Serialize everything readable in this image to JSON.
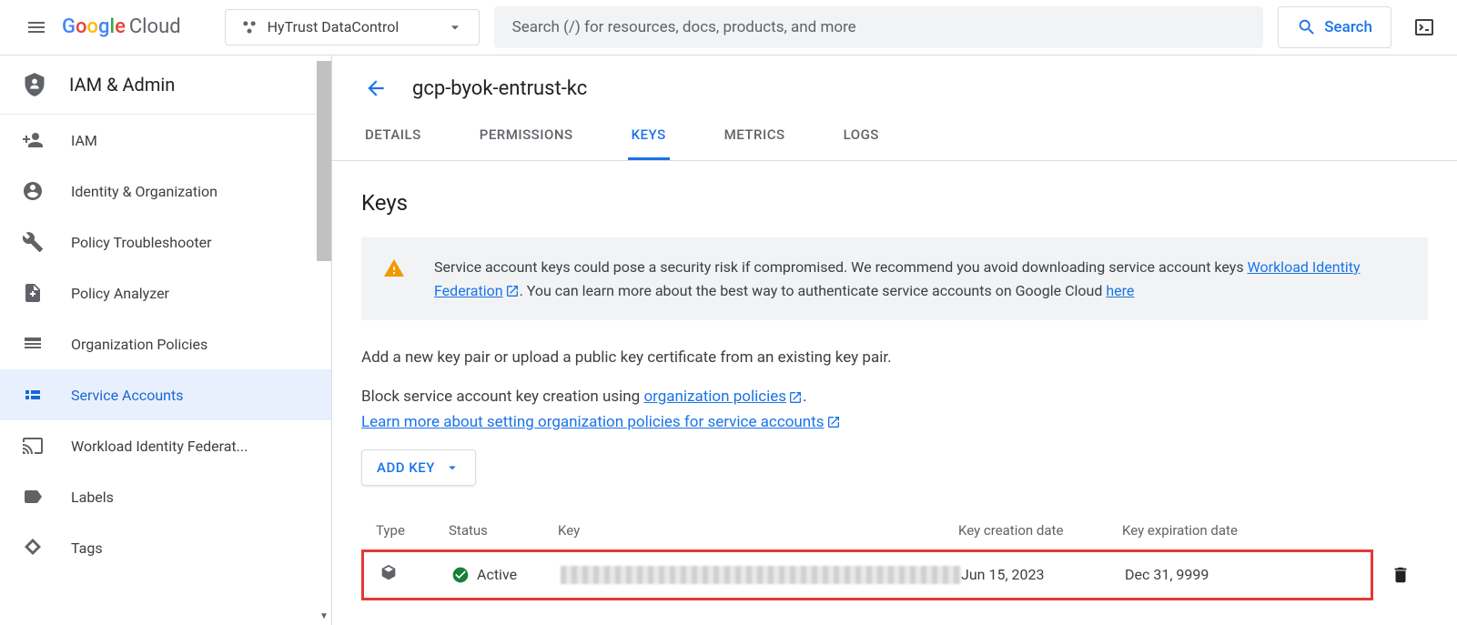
{
  "header": {
    "logo_cloud": "Cloud",
    "project_name": "HyTrust DataControl",
    "search_placeholder": "Search (/) for resources, docs, products, and more",
    "search_button": "Search"
  },
  "sidebar": {
    "section_title": "IAM & Admin",
    "items": [
      {
        "label": "IAM"
      },
      {
        "label": "Identity & Organization"
      },
      {
        "label": "Policy Troubleshooter"
      },
      {
        "label": "Policy Analyzer"
      },
      {
        "label": "Organization Policies"
      },
      {
        "label": "Service Accounts"
      },
      {
        "label": "Workload Identity Federat..."
      },
      {
        "label": "Labels"
      },
      {
        "label": "Tags"
      }
    ]
  },
  "page": {
    "title": "gcp-byok-entrust-kc",
    "tabs": [
      "DETAILS",
      "PERMISSIONS",
      "KEYS",
      "METRICS",
      "LOGS"
    ],
    "heading": "Keys",
    "warning_text1": "Service account keys could pose a security risk if compromised. We recommend you avoid downloading service account keys ",
    "warning_link1": "Workload Identity Federation",
    "warning_text2": ". You can learn more about the best way to authenticate service accounts on Google Cloud ",
    "warning_link2": "here",
    "para1": "Add a new key pair or upload a public key certificate from an existing key pair.",
    "para2a": "Block service account key creation using ",
    "para2_link": "organization policies",
    "para3_link": "Learn more about setting organization policies for service accounts",
    "add_key": "ADD KEY",
    "columns": {
      "type": "Type",
      "status": "Status",
      "key": "Key",
      "created": "Key creation date",
      "expires": "Key expiration date"
    },
    "rows": [
      {
        "status": "Active",
        "created": "Jun 15, 2023",
        "expires": "Dec 31, 9999"
      }
    ]
  }
}
